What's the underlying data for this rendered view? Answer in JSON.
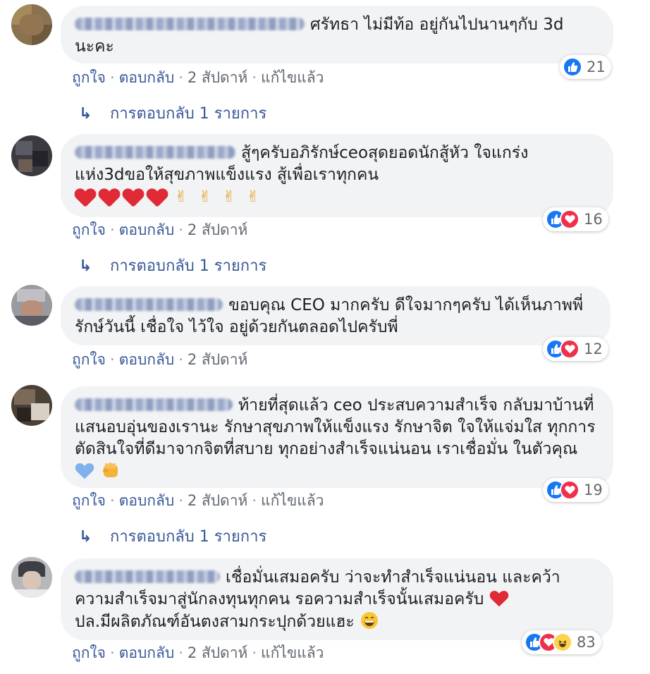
{
  "comments": [
    {
      "author": "Kaidchapara Puenchmana",
      "text": "ศรัทธา ไม่มีท้อ อยู่กันไปนานๆกับ 3d นะคะ",
      "reactions": [
        "like"
      ],
      "reaction_count": "21",
      "actions": {
        "like": "ถูกใจ",
        "reply": "ตอบกลับ",
        "time": "2 สัปดาห์",
        "edited": "แก้ไขแล้ว"
      },
      "replies_label": "การตอบกลับ 1 รายการ"
    },
    {
      "author": "Aopas Sitiyiwamoat",
      "text": "สู้ๆครับอภิรักษ์ceoสุดยอดนักสู้หัว ใจแกร่งแห่ง3dขอให้สุขภาพแข็งแรง สู้เพื่อเราทุกคน",
      "emojis": [
        "red-heart",
        "red-heart",
        "red-heart",
        "red-heart",
        "victory-hand",
        "victory-hand",
        "victory-hand",
        "victory-hand"
      ],
      "reactions": [
        "like",
        "love"
      ],
      "reaction_count": "16",
      "actions": {
        "like": "ถูกใจ",
        "reply": "ตอบกลับ",
        "time": "2 สัปดาห์"
      },
      "replies_label": "การตอบกลับ 1 รายการ"
    },
    {
      "author": "Yayaus Wangsad",
      "text": "ขอบคุณ CEO มากครับ ดีใจมากๆครับ ได้เห็นภาพพี่รักษ์วันนี้ เชื่อใจ ไว้ใจ อยู่ด้วยกันตลอดไปครับพี่",
      "reactions": [
        "like",
        "love"
      ],
      "reaction_count": "12",
      "actions": {
        "like": "ถูกใจ",
        "reply": "ตอบกลับ",
        "time": "2 สัปดาห์"
      }
    },
    {
      "author": "Mingkwan Mirrele",
      "text": "ท้ายที่สุดแล้ว ceo ประสบความสำเร็จ กลับมาบ้านที่แสนอบอุ่นของเรานะ รักษาสุขภาพให้แข็งแรง รักษาจิต ใจให้แจ่มใส ทุกการตัดสินใจที่ดีมาจากจิตที่สบาย ทุกอย่างสำเร็จแน่นอน เราเชื่อมั่น ในตัวคุณ",
      "reactions": [
        "like",
        "love"
      ],
      "reaction_count": "19",
      "actions": {
        "like": "ถูกใจ",
        "reply": "ตอบกลับ",
        "time": "2 สัปดาห์",
        "edited": "แก้ไขแล้ว"
      },
      "replies_label": "การตอบกลับ 1 รายการ"
    },
    {
      "author": "Kanjabun Manut",
      "text": "เชื่อมั่นเสมอครับ ว่าจะทำสำเร็จแน่นอน และคว้าความสำเร็จมาสู่นักลงทุนทุกคน รอความสำเร็จนั้นเสมอครับ",
      "text2": "ปล.มีผลิตภัณฑ์อันตงสามกระปุกด้วยแฮะ",
      "reactions": [
        "like",
        "love",
        "haha"
      ],
      "reaction_count": "83",
      "actions": {
        "like": "ถูกใจ",
        "reply": "ตอบกลับ",
        "time": "2 สัปดาห์",
        "edited": "แก้ไขแล้ว"
      }
    }
  ],
  "colors": {
    "link": "#385898",
    "bubble": "#f2f3f5",
    "like": "#1877f2",
    "love": "#f0304a"
  }
}
